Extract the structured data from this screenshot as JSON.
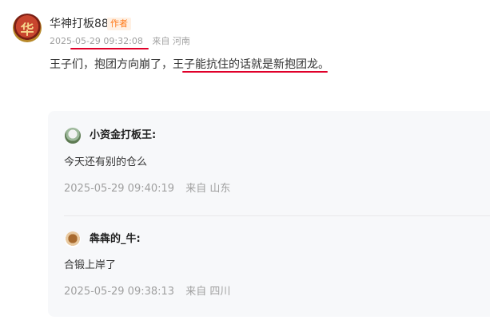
{
  "post": {
    "author": "华神打板88",
    "badge": "作者",
    "timestamp": "2025-05-29 09:32:08",
    "location": "来自 河南",
    "content": "王子们，抱团方向崩了，王子能抗住的话就是新抱团龙。",
    "avatar_glyph": "华",
    "highlight_color": "#e0002a"
  },
  "replies": [
    {
      "author": "小资金打板王:",
      "text": "今天还有别的仓么",
      "timestamp": "2025-05-29 09:40:19",
      "location": "来自 山东"
    },
    {
      "author": "犇犇的_牛:",
      "text": "合锻上岸了",
      "timestamp": "2025-05-29 09:38:13",
      "location": "来自 四川"
    }
  ]
}
